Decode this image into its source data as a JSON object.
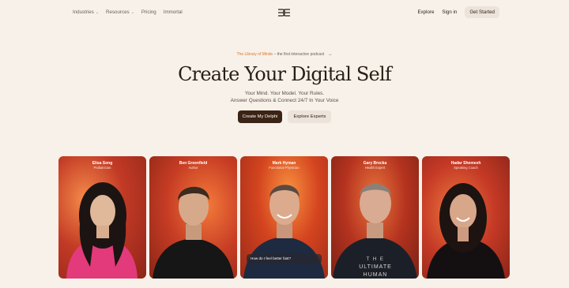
{
  "nav": {
    "left": [
      {
        "label": "Industries",
        "dropdown": true
      },
      {
        "label": "Resources",
        "dropdown": true
      },
      {
        "label": "Pricing",
        "dropdown": false
      },
      {
        "label": "Immortal",
        "dropdown": false
      }
    ],
    "explore": "Explore",
    "signin": "Sign in",
    "get_started": "Get Started",
    "logo_icon": "delphi-logo-icon"
  },
  "hero": {
    "announce_highlight": "The Library of Minds",
    "announce_rest": "– the first interactive podcast",
    "title": "Create Your Digital Self",
    "subtitle_line1": "Your Mind. Your Model. Your Rules.",
    "subtitle_line2": "Answer Questions & Connect 24/7 In Your Voice",
    "cta_primary": "Create My Delphi",
    "cta_secondary": "Explore Experts"
  },
  "cards": [
    {
      "name": "Elisa Song",
      "role": "Pediatrician",
      "bg": "#c23a25"
    },
    {
      "name": "Ben Greenfield",
      "role": "Author",
      "bg": "#c63c24"
    },
    {
      "name": "Mark Hyman",
      "role": "Functional Physician",
      "bg": "#d4441f",
      "chat": "How do I feel better fast?"
    },
    {
      "name": "Gary Brecka",
      "role": "Health Expert",
      "bg": "#b5331f"
    },
    {
      "name": "Hadar Shemesh",
      "role": "Speaking Coach",
      "bg": "#c53a26"
    }
  ]
}
